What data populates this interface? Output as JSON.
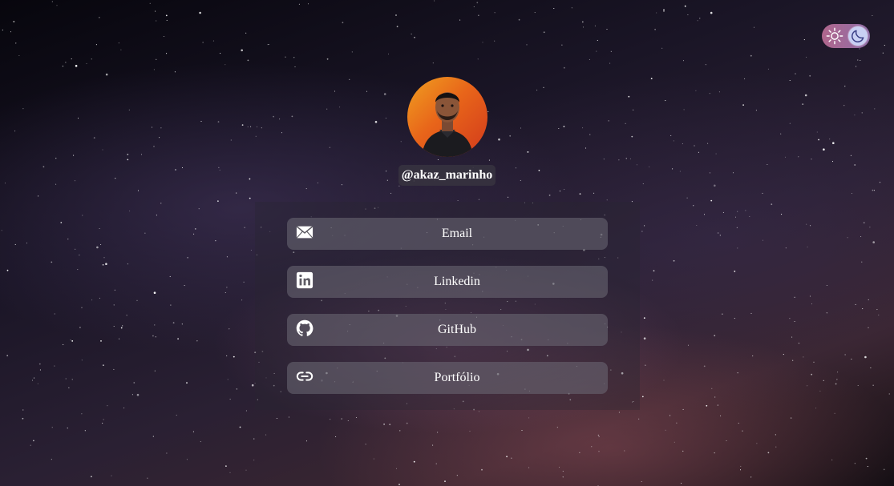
{
  "theme_toggle": {
    "left_icon": "sun-icon",
    "right_icon": "moon-icon",
    "colors": {
      "track": "#b0668c",
      "knob": "#c9d0f3",
      "icon": "#ffffff"
    }
  },
  "profile": {
    "avatar": "profile-photo",
    "username": "@akaz_marinho",
    "avatar_ring_colors": [
      "#f0a020",
      "#e8651a",
      "#d23a1c"
    ]
  },
  "links": [
    {
      "label": "Email",
      "icon": "mail-icon"
    },
    {
      "label": "Linkedin",
      "icon": "linkedin-icon"
    },
    {
      "label": "GitHub",
      "icon": "github-icon"
    },
    {
      "label": "Portfólio",
      "icon": "link-icon"
    }
  ]
}
